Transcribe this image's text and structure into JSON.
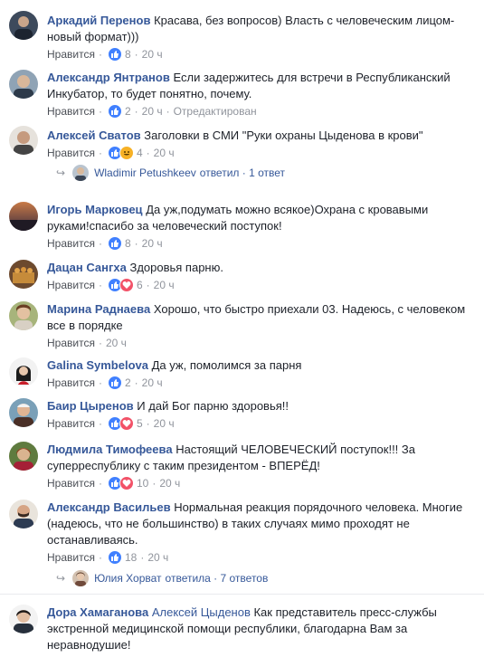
{
  "like_label": "Нравится",
  "edited_label": "Отредактирован",
  "comments": [
    {
      "name": "Аркадий Перенов",
      "text": "Красава, без вопросов) Власть с человеческим лицом-новый формат)))",
      "reactions": "8",
      "time": "20 ч"
    },
    {
      "name": "Александр Янтранов",
      "text": "Если задержитесь для встречи в Республиканский Инкубатор, то будет понятно, почему.",
      "reactions": "2",
      "time": "20 ч"
    },
    {
      "name": "Алексей Сватов",
      "text": "Заголовки в СМИ \"Руки охраны Цыденова в крови\"",
      "reactions": "4",
      "time": "20 ч"
    },
    {
      "name": "Игорь Марковец",
      "text": "Да уж,подумать можно всякое)Охрана с кровавыми руками!спасибо за человеческий поступок!",
      "reactions": "8",
      "time": "20 ч"
    },
    {
      "name": "Дацан Сангха",
      "text": "Здоровья парню.",
      "reactions": "6",
      "time": "20 ч"
    },
    {
      "name": "Марина Раднаева",
      "text": "Хорошо, что быстро приехали 03. Надеюсь, с человеком все в порядке",
      "time": "20 ч"
    },
    {
      "name": "Galina Symbelova",
      "text": "Да уж, помолимся за парня",
      "reactions": "2",
      "time": "20 ч"
    },
    {
      "name": "Баир Цыренов",
      "text": "И дай Бог парню здоровья!!",
      "reactions": "5",
      "time": "20 ч"
    },
    {
      "name": "Людмила Тимофеева",
      "text": "Настоящий ЧЕЛОВЕЧЕСКИЙ поступок!!! За суперреспублику с таким президентом - ВПЕРЁД!",
      "reactions": "10",
      "time": "20 ч"
    },
    {
      "name": "Александр Васильев",
      "text": "Нормальная реакция порядочного человека. Многие (надеюсь, что не большинство) в таких случаях мимо проходят не останавливаясь.",
      "reactions": "18",
      "time": "20 ч"
    },
    {
      "name": "Дора Хамаганова",
      "mention": "Алексей Цыденов",
      "text": "Как представитель пресс-службы экстренной медицинской помощи республики, благодарна Вам за неравнодушие!"
    }
  ],
  "replies": [
    {
      "name": "Wladimir Petushkeev",
      "text": "ответил · 1 ответ"
    },
    {
      "name": "Юлия Хорват",
      "text": "ответила · 7 ответов"
    }
  ],
  "colors": {
    "link": "#365899",
    "meta": "#90949c",
    "like": "#4080ff",
    "love": "#f25268",
    "haha": "#f7b125"
  }
}
